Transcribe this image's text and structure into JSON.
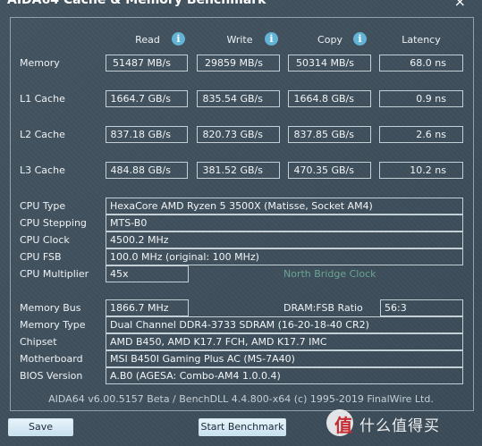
{
  "window": {
    "title": "AIDA64 Cache & Memory Benchmark",
    "close_glyph": "×"
  },
  "columns": {
    "read": "Read",
    "write": "Write",
    "copy": "Copy",
    "latency": "Latency",
    "info_glyph": "i"
  },
  "rows": {
    "memory": {
      "label": "Memory",
      "read": "51487 MB/s",
      "write": "29859 MB/s",
      "copy": "50314 MB/s",
      "latency": "68.0 ns"
    },
    "l1": {
      "label": "L1 Cache",
      "read": "1664.7 GB/s",
      "write": "835.54 GB/s",
      "copy": "1664.8 GB/s",
      "latency": "0.9 ns"
    },
    "l2": {
      "label": "L2 Cache",
      "read": "837.18 GB/s",
      "write": "820.73 GB/s",
      "copy": "837.85 GB/s",
      "latency": "2.6 ns"
    },
    "l3": {
      "label": "L3 Cache",
      "read": "484.88 GB/s",
      "write": "381.52 GB/s",
      "copy": "470.35 GB/s",
      "latency": "10.2 ns"
    }
  },
  "cpu": {
    "type_label": "CPU Type",
    "type_value": "HexaCore AMD Ryzen 5 3500X  (Matisse, Socket AM4)",
    "stepping_label": "CPU Stepping",
    "stepping_value": "MTS-B0",
    "clock_label": "CPU Clock",
    "clock_value": "4500.2 MHz",
    "fsb_label": "CPU FSB",
    "fsb_value": "100.0 MHz  (original: 100 MHz)",
    "multiplier_label": "CPU Multiplier",
    "multiplier_value": "45x",
    "north_bridge_label": "North Bridge Clock"
  },
  "system": {
    "bus_label": "Memory Bus",
    "bus_value": "1866.7 MHz",
    "ratio_label": "DRAM:FSB Ratio",
    "ratio_value": "56:3",
    "memtype_label": "Memory Type",
    "memtype_value": "Dual Channel DDR4-3733 SDRAM  (16-20-18-40 CR2)",
    "chipset_label": "Chipset",
    "chipset_value": "AMD B450, AMD K17.7 FCH, AMD K17.7 IMC",
    "mobo_label": "Motherboard",
    "mobo_value": "MSI B450I Gaming Plus AC (MS-7A40)",
    "bios_label": "BIOS Version",
    "bios_value": "A.B0  (AGESA: Combo-AM4 1.0.0.4)"
  },
  "footer": {
    "version": "AIDA64 v6.00.5157 Beta / BenchDLL 4.4.800-x64  (c) 1995-2019 FinalWire Ltd."
  },
  "buttons": {
    "save": "Save",
    "start": "Start Benchmark"
  },
  "watermark": {
    "glyph": "值",
    "text": "什么值得买"
  }
}
